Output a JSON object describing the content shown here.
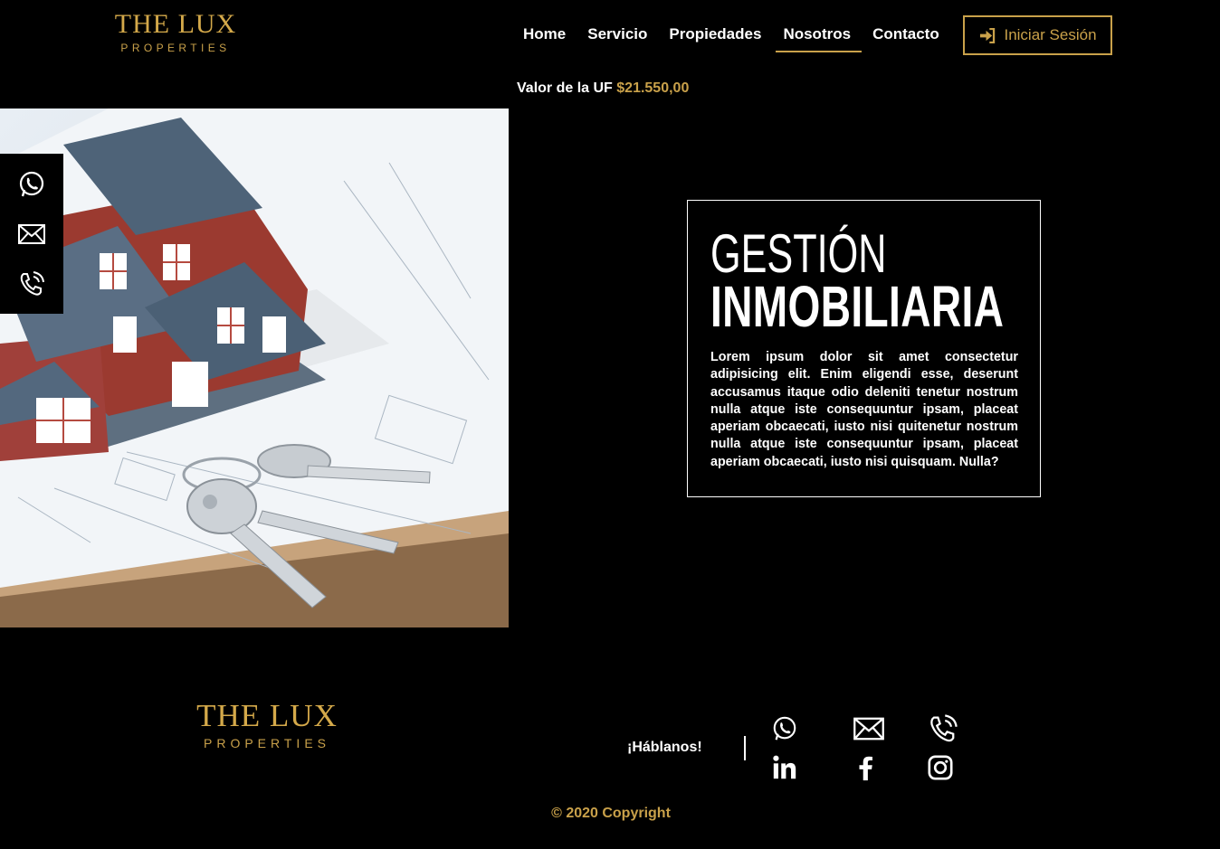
{
  "brand": {
    "name_line1": "THE LUX",
    "name_line2": "PROPERTIES",
    "gold": "#c9a14a"
  },
  "nav": {
    "items": [
      {
        "label": "Home"
      },
      {
        "label": "Servicio"
      },
      {
        "label": "Propiedades"
      },
      {
        "label": "Nosotros",
        "active": true
      },
      {
        "label": "Contacto"
      }
    ],
    "login_label": "Iniciar Sesión",
    "login_icon": "sign-in-icon"
  },
  "uf": {
    "label": "Valor de la UF",
    "value": "$21.550,00"
  },
  "hero": {
    "image": "house-model-with-keys-on-blueprints",
    "side_icons": [
      "whatsapp-icon",
      "mail-icon",
      "phone-icon"
    ]
  },
  "section": {
    "title_line1": "GESTIÓN",
    "title_line2": "INMOBILIARIA",
    "description": "Lorem ipsum dolor sit amet consectetur adipisicing elit. Enim eligendi esse, deserunt accusamus itaque odio deleniti tenetur nostrum nulla atque iste consequuntur ipsam, placeat aperiam obcaecati, iusto nisi quitenetur nostrum nulla atque iste consequuntur ipsam, placeat aperiam obcaecati, iusto nisi quisquam. Nulla?"
  },
  "footer": {
    "talk_label": "¡Háblanos!",
    "icons_row1": [
      "whatsapp-icon",
      "mail-icon",
      "phone-icon"
    ],
    "icons_row2": [
      "linkedin-icon",
      "facebook-icon",
      "instagram-icon"
    ],
    "copyright": "© 2020 Copyright"
  }
}
